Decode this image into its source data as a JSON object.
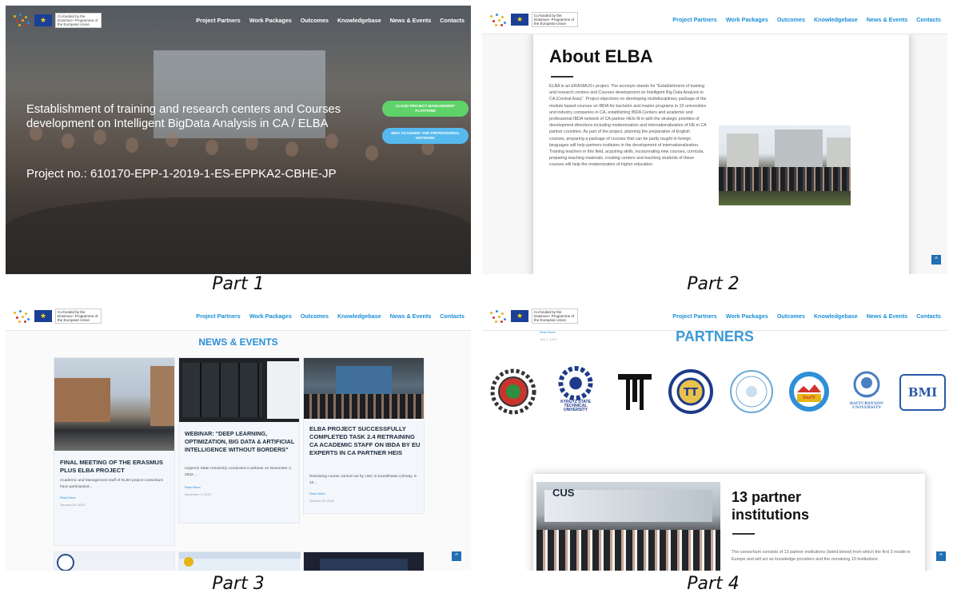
{
  "header": {
    "cofunded": "Co-funded by the Erasmus+ Programme of the European Union",
    "nav": [
      "Project Partners",
      "Work Packages",
      "Outcomes",
      "Knowledgebase",
      "News & Events",
      "Contacts"
    ]
  },
  "captions": [
    "Part 1",
    "Part 2",
    "Part 3",
    "Part 4"
  ],
  "part1": {
    "title": "Establishment of training and research centers and Courses development on Intelligent BigData Analysis in CA / ELBA",
    "project_no": "Project no.: 610170-EPP-1-2019-1-ES-EPPKA2-CBHE-JP",
    "btn_cloud": "CLOUD PROJECT MANAGEMENT PLATFORM",
    "btn_ibda": "IBDA ACADEMIC AND PROFESSIONAL NETWORK"
  },
  "part2": {
    "heading": "About ELBA",
    "body": "ELBA is an ERASMUS+ project. The acronym stands for \"Establishment of training and research centers and Courses development on Intelligent Big Data Analysis in CA (Central Asia)\". Project objectives on developing multidisciplinary package of the module based courses on IBDA for bachelor and master programs in 10 universities and industry companies in CA, establishing IBDA Centers and academic and professional IBDA network of CA partner HEIs fit in with the strategic priorities of development directions including modernization and internationalization of HE in CA partner countries. As part of the project, planning the preparation of English courses, preparing a package of courses that can be partly taught in foreign languages will help partners institutes in the development of internationalization. Training teachers in this field, acquiring skills, incorporating new courses, curricula, preparing teaching materials, creating centers and teaching students of these courses will help the modernization of higher education."
  },
  "part3": {
    "section_title": "NEWS & EVENTS",
    "news": [
      {
        "title": "FINAL MEETING OF THE ERASMUS PLUS ELBA PROJECT",
        "excerpt": "Academic and Management staff of ELBA project consortium have participated...",
        "read_more": "Read More",
        "date": "January 26, 2023"
      },
      {
        "title": "WEBINAR: \"DEEP LEARNING, OPTIMIZATION, BIG DATA & ARTIFICIAL INTELLIGENCE WITHOUT BORDERS\"",
        "excerpt": "Urgench State University conducted a webinar on November 2, 2022....",
        "read_more": "Read More",
        "date": "November 4, 2022"
      },
      {
        "title": "ELBA PROJECT SUCCESSFULLY COMPLETED TASK 2.4 RETRAINING CA ACADEMIC STAFF ON IBDA BY EU EXPERTS IN CA PARTNER HEIS",
        "excerpt": "Retraining course carried out by USC in Kazakhstan (Almaty, 6-10...",
        "read_more": "Read More",
        "date": "October 20, 2022"
      }
    ]
  },
  "part4": {
    "read_more": "Read More",
    "date": "July 1, 2022",
    "section_title": "PARTNERS",
    "partner_labels": [
      "KYRGYZ STATE TECHNICAL UNIVERSITY",
      "OшТУ",
      "BAITURSYNOV UNIVERSITY",
      "BMI"
    ],
    "heading": "13 partner institutions",
    "text": "The consortium consists of 13 partner institutions (listed below) from which the first 3 reside in Europe and will act as knowledge providers and the remaining 10 institutions"
  }
}
